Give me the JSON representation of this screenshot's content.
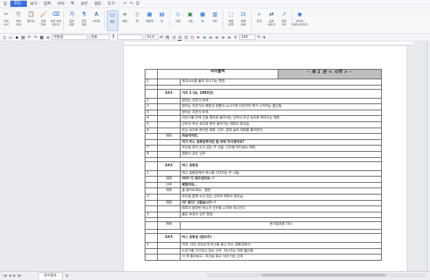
{
  "menubar": {
    "items": [
      {
        "label": "일",
        "active": false
      },
      {
        "label": "편집 ·",
        "active": true
      },
      {
        "label": "보기 ·",
        "active": false
      },
      {
        "label": "입력 ·",
        "active": false
      },
      {
        "label": "서식 ·",
        "active": false
      },
      {
        "label": "쪽 ·",
        "active": false
      },
      {
        "label": "보안 ·",
        "active": false
      },
      {
        "label": "검토 ·",
        "active": false
      },
      {
        "label": "도구 ·",
        "active": false
      }
    ],
    "tool_icons": [
      "undo-icon",
      "redo-icon",
      "hamburger-icon"
    ]
  },
  "ribbon": {
    "buttons": [
      {
        "label": "오려\n두기",
        "icon": "cut-icon",
        "glyph": "✂"
      },
      {
        "label": "복사\n하기",
        "icon": "copy-icon",
        "glyph": "⎘"
      },
      {
        "label": "붙이기",
        "icon": "paste-icon",
        "glyph": "📋"
      },
      {
        "label": "모양\n복사",
        "icon": "format-painter-icon",
        "glyph": "🖌"
      },
      {
        "label": "조판 부호\n지우기",
        "icon": "eraser-icon",
        "glyph": "⌫"
      },
      {
        "label": "글자\n모양",
        "icon": "char-shape-icon",
        "glyph": "가"
      },
      {
        "label": "문단\n모양",
        "icon": "para-shape-icon",
        "glyph": "¶"
      },
      {
        "label": "스타일",
        "icon": "style-icon",
        "glyph": "A"
      },
      {
        "label": "쪽윤",
        "icon": "page-view-icon",
        "glyph": "▭",
        "selected": true
      },
      {
        "label": "개요",
        "icon": "outline-icon",
        "glyph": "≡"
      },
      {
        "label": "쪽",
        "icon": "page-icon",
        "glyph": "▯"
      },
      {
        "label": "바탕쪽",
        "icon": "master-page-icon",
        "glyph": "▦"
      },
      {
        "label": "망",
        "icon": "grid-icon",
        "glyph": "▤"
      },
      {
        "label": "도형",
        "icon": "shape-icon",
        "glyph": "◇"
      },
      {
        "label": "그림",
        "icon": "picture-icon",
        "glyph": "▣"
      },
      {
        "label": "표",
        "icon": "table-icon",
        "glyph": "▦"
      },
      {
        "label": "차트",
        "icon": "chart-icon",
        "glyph": "▥"
      },
      {
        "label": "개체\n선택",
        "icon": "object-select-icon",
        "glyph": "⬚"
      },
      {
        "label": "개체\n보호",
        "icon": "object-protect-icon",
        "glyph": "⊡"
      },
      {
        "label": "찾기",
        "icon": "find-icon",
        "glyph": "⌕"
      },
      {
        "label": "글자\n바꾸기",
        "icon": "replace-icon",
        "glyph": "⇄"
      },
      {
        "label": "찾아\n가기",
        "icon": "goto-icon",
        "glyph": "↗"
      },
      {
        "label": "유피스\n커뮤니티이어",
        "icon": "community-icon",
        "glyph": "◉"
      }
    ]
  },
  "formatbar": {
    "style_value": "바탕글",
    "font_lang": "대표",
    "font_name": "",
    "font_size": "10.0",
    "font_unit": "pt",
    "zoom": "160",
    "zoom_unit": "%"
  },
  "document": {
    "header": {
      "label": "타이틀백",
      "banner": "- 제 1 권 < 시작 > -"
    },
    "rows": [
      {
        "type": "line",
        "num": "1",
        "spk": "",
        "text": "계곡사이를 흘러 지나가는 화면.",
        "bold": false
      },
      {
        "type": "blank"
      },
      {
        "type": "scene",
        "no": "S#1",
        "title": "거리 1 (낮, 1983년)"
      },
      {
        "type": "line",
        "num": "1",
        "spk": "",
        "text": "달리는 자전거 바퀴.",
        "bold": false
      },
      {
        "type": "line",
        "num": "2",
        "spk": "",
        "text": "달리는 자전거의 페달과 뒷편의 소나기에 이리저리 튀기 시작하는 펌인들.",
        "bold": false
      },
      {
        "type": "line",
        "num": "3",
        "spk": "",
        "text": "달리는 자전거 바퀴.",
        "bold": false
      },
      {
        "type": "line",
        "num": "4",
        "spk": "",
        "text": "자전거를 미해 건물 쪽으로 몰아서는 인우의 우산 속으로 뛰어드는 태희.",
        "bold": false
      },
      {
        "type": "line",
        "num": "5",
        "spk": "",
        "text": "인우의 우산 속으로 뛰어 들어가는 태희의 뒷모습.",
        "bold": false
      },
      {
        "type": "line",
        "num": "6",
        "spk": "",
        "text": "우산 속으로 뛰어든 태희. 인우. 깜짝 놀라 태희를 돌아본다.",
        "bold": false
      },
      {
        "type": "line",
        "num": "",
        "spk": "태희",
        "text": "죄송하지만,",
        "bold": true
      },
      {
        "type": "line",
        "num": "",
        "spk": "",
        "text": "저기 버스 정류장까지만 좀 씌워 주시겠어요?",
        "bold": true
      },
      {
        "type": "line",
        "num": "7",
        "spk": "",
        "text": "우산을 같이 쓰고 걷는 두 사람. 인우를 쳐다보는 태희.",
        "bold": false
      },
      {
        "type": "line",
        "num": "8",
        "spk": "",
        "text": "말없이 걷는 인우.",
        "bold": false
      },
      {
        "type": "blank"
      },
      {
        "type": "scene",
        "no": "S#2",
        "title": "버스 정류장"
      },
      {
        "type": "line",
        "num": "1",
        "spk": "",
        "text": "버스 정류장에서 버스를 기다리는 두 사람.",
        "bold": false
      },
      {
        "type": "line",
        "num": "",
        "spk": "태희",
        "text": "어머! 다 젖으셨어요~!",
        "bold": true
      },
      {
        "type": "line",
        "num": "",
        "spk": "인우",
        "text": "괜찮아요..",
        "bold": true
      },
      {
        "type": "line",
        "num": "",
        "spk": "태희",
        "text": "좀 들어오세요.. 얼른..",
        "bold": false
      },
      {
        "type": "line",
        "num": "2",
        "spk": "",
        "text": "우산을 함께 쓰고 있는 인우와 태희의 뒷모습.",
        "bold": false
      },
      {
        "type": "line",
        "num": "",
        "spk": "태희",
        "text": "아! 왔다! 고맙습니다~!",
        "bold": true
      },
      {
        "type": "line",
        "num": "",
        "spk": "",
        "text": "태희가 올라탄 버스가 인우를 스치며 지나간다.",
        "bold": false
      },
      {
        "type": "line",
        "num": "3",
        "spk": "",
        "text": "홀린 표정의 인우 얼굴.",
        "bold": false
      },
      {
        "type": "blank"
      },
      {
        "type": "subtitle",
        "label": "제목",
        "text": "번지점프를 하다"
      },
      {
        "type": "blank"
      },
      {
        "type": "scene",
        "no": "S#3",
        "title": "버스 정류장 (밤타주)"
      },
      {
        "type": "line",
        "num": "1",
        "spk": "",
        "text": "저녁, 비도 안오는데 우산을 들고 버스 정류장에서",
        "bold": false
      },
      {
        "type": "line",
        "num": "",
        "spk": "",
        "text": "누군가를 기다리고 있는 인우. 지나가는 처희 팸인들",
        "bold": false
      },
      {
        "type": "line",
        "num": "",
        "spk": "",
        "text": "이 쳐 들아보고.. 우산을 들고 서성 이는 인우",
        "bold": false
      }
    ]
  },
  "bottombar": {
    "tab_label": "번지점프",
    "add_label": "+"
  }
}
